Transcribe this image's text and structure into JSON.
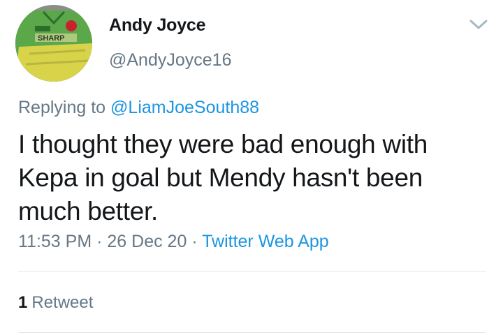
{
  "user": {
    "display_name": "Andy Joyce",
    "handle": "@AndyJoyce16",
    "avatar_jersey_text": "SHARP"
  },
  "reply": {
    "prefix": "Replying to",
    "to_handle": "@LiamJoeSouth88"
  },
  "tweet": {
    "text_lines": [
      "I thought they were bad enough with",
      "Kepa in goal but Mendy hasn't been",
      "much better."
    ],
    "time": "11:53 PM",
    "date": "26 Dec 20",
    "separator": "·",
    "source": "Twitter Web App"
  },
  "stats": {
    "retweet_count": "1",
    "retweet_label": "Retweet"
  },
  "colors": {
    "link": "#1b95e0",
    "secondary_text": "#657786",
    "divider": "#e1e8ed"
  },
  "icons": {
    "menu": "chevron-down-icon"
  }
}
